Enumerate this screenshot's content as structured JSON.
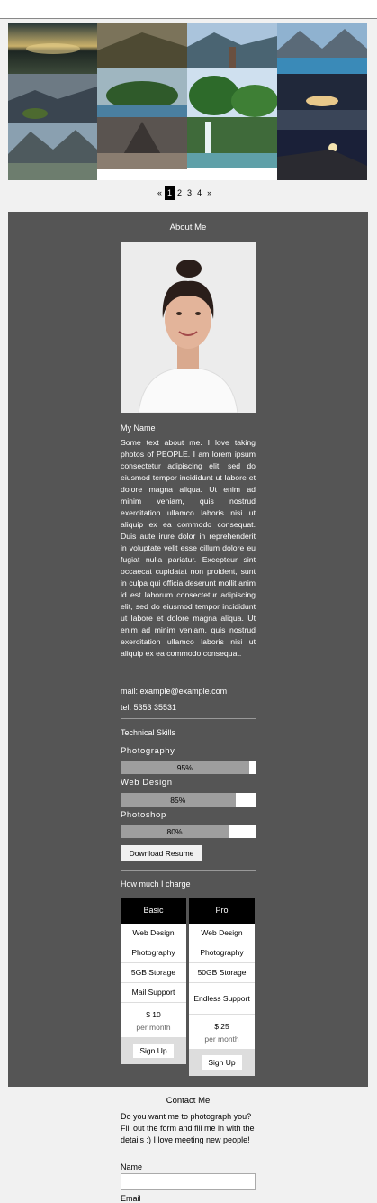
{
  "pagination": {
    "prev": "«",
    "pages": [
      "1",
      "2",
      "3",
      "4"
    ],
    "active": "1",
    "next": "»"
  },
  "about": {
    "title": "About Me",
    "name": "My Name",
    "bio": "Some text about me. I love taking photos of PEOPLE. I am lorem ipsum consectetur adipiscing elit, sed do eiusmod tempor incididunt ut labore et dolore magna aliqua. Ut enim ad minim veniam, quis nostrud exercitation ullamco laboris nisi ut aliquip ex ea commodo consequat. Duis aute irure dolor in reprehenderit in voluptate velit esse cillum dolore eu fugiat nulla pariatur. Excepteur sint occaecat cupidatat non proident, sunt in culpa qui officia deserunt mollit anim id est laborum consectetur adipiscing elit, sed do eiusmod tempor incididunt ut labore et dolore magna aliqua. Ut enim ad minim veniam, quis nostrud exercitation ullamco laboris nisi ut aliquip ex ea commodo consequat.",
    "mail": "mail: example@example.com",
    "tel": "tel: 5353 35531"
  },
  "skills": {
    "title": "Technical Skills",
    "items": [
      {
        "label": "Photography",
        "percent_text": "95%",
        "level": 95
      },
      {
        "label": "Web Design",
        "percent_text": "85%",
        "level": 85
      },
      {
        "label": "Photoshop",
        "percent_text": "80%",
        "level": 80
      }
    ],
    "download_label": "Download Resume"
  },
  "pricing": {
    "title": "How much I charge",
    "plans": [
      {
        "name": "Basic",
        "features": [
          "Web Design",
          "Photography",
          "5GB Storage",
          "Mail Support"
        ],
        "price": "$ 10",
        "period": "per month",
        "cta": "Sign Up"
      },
      {
        "name": "Pro",
        "features": [
          "Web Design",
          "Photography",
          "50GB Storage",
          "Endless Support"
        ],
        "price": "$ 25",
        "period": "per month",
        "cta": "Sign Up"
      }
    ]
  },
  "contact": {
    "title": "Contact Me",
    "text": "Do you want me to photograph you? Fill out the form and fill me in with the details :) I love meeting new people!",
    "name_label": "Name",
    "email_label": "Email",
    "name_value": "",
    "email_value": ""
  }
}
